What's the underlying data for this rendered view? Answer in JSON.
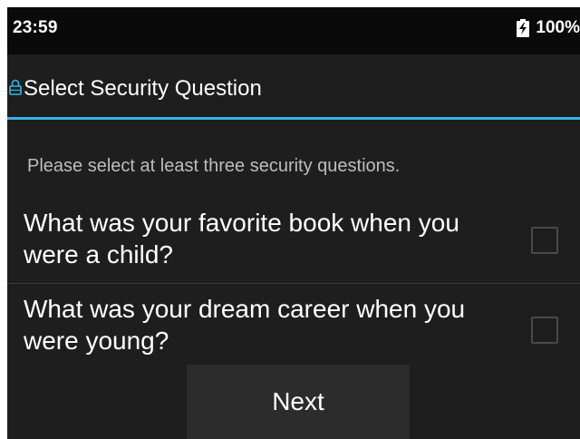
{
  "status_bar": {
    "time": "23:59",
    "battery_icon": "battery-charging-icon",
    "battery_level": "100%"
  },
  "header": {
    "icon": "lock-icon",
    "title": "Select Security Question",
    "accent_color": "#33b5e5"
  },
  "main": {
    "instruction": "Please select at least three security questions.",
    "questions": [
      {
        "text": "What was your favorite book when you were a child?",
        "checked": false
      },
      {
        "text": "What was your dream career when you were young?",
        "checked": false
      }
    ]
  },
  "footer": {
    "next_label": "Next"
  }
}
